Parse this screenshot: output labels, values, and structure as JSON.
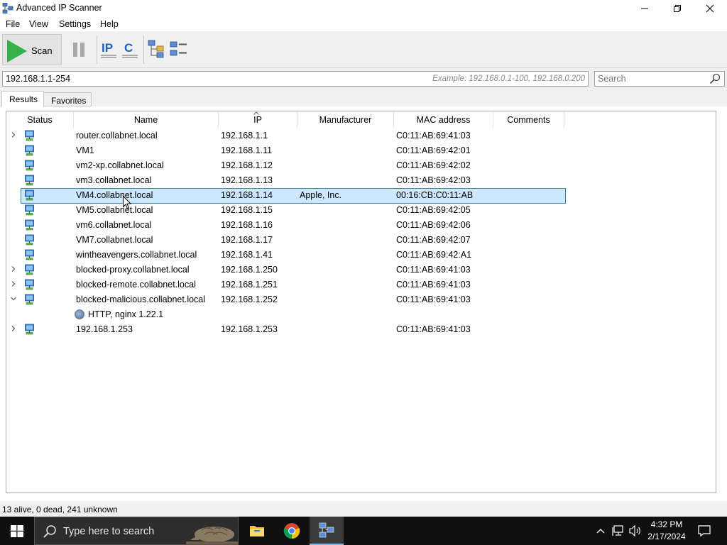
{
  "window": {
    "title": "Advanced IP Scanner"
  },
  "menu": [
    "File",
    "View",
    "Settings",
    "Help"
  ],
  "toolbar": {
    "scan_label": "Scan"
  },
  "address": {
    "value": "192.168.1.1-254",
    "example": "Example: 192.168.0.1-100, 192.168.0.200",
    "search_placeholder": "Search"
  },
  "tabs": [
    "Results",
    "Favorites"
  ],
  "columns": [
    "Status",
    "Name",
    "IP",
    "Manufacturer",
    "MAC address",
    "Comments"
  ],
  "rows": [
    {
      "expander": "collapsed",
      "name": "router.collabnet.local",
      "ip": "192.168.1.1",
      "manufacturer": "",
      "mac": "C0:11:AB:69:41:03"
    },
    {
      "expander": "none",
      "name": "VM1",
      "ip": "192.168.1.11",
      "manufacturer": "",
      "mac": "C0:11:AB:69:42:01"
    },
    {
      "expander": "none",
      "name": "vm2-xp.collabnet.local",
      "ip": "192.168.1.12",
      "manufacturer": "",
      "mac": "C0:11:AB:69:42:02"
    },
    {
      "expander": "none",
      "name": "vm3.collabnet.local",
      "ip": "192.168.1.13",
      "manufacturer": "",
      "mac": "C0:11:AB:69:42:03"
    },
    {
      "expander": "none",
      "name": "VM4.collabnet.local",
      "ip": "192.168.1.14",
      "manufacturer": "Apple, Inc.",
      "mac": "00:16:CB:C0:11:AB",
      "selected": true
    },
    {
      "expander": "none",
      "name": "VM5.collabnet.local",
      "ip": "192.168.1.15",
      "manufacturer": "",
      "mac": "C0:11:AB:69:42:05"
    },
    {
      "expander": "none",
      "name": "vm6.collabnet.local",
      "ip": "192.168.1.16",
      "manufacturer": "",
      "mac": "C0:11:AB:69:42:06"
    },
    {
      "expander": "none",
      "name": "VM7.collabnet.local",
      "ip": "192.168.1.17",
      "manufacturer": "",
      "mac": "C0:11:AB:69:42:07"
    },
    {
      "expander": "none",
      "name": "wintheavengers.collabnet.local",
      "ip": "192.168.1.41",
      "manufacturer": "",
      "mac": "C0:11:AB:69:42:A1"
    },
    {
      "expander": "collapsed",
      "name": "blocked-proxy.collabnet.local",
      "ip": "192.168.1.250",
      "manufacturer": "",
      "mac": "C0:11:AB:69:41:03"
    },
    {
      "expander": "collapsed",
      "name": "blocked-remote.collabnet.local",
      "ip": "192.168.1.251",
      "manufacturer": "",
      "mac": "C0:11:AB:69:41:03"
    },
    {
      "expander": "expanded",
      "name": "blocked-malicious.collabnet.local",
      "ip": "192.168.1.252",
      "manufacturer": "",
      "mac": "C0:11:AB:69:41:03"
    },
    {
      "child": true,
      "name": "HTTP, nginx 1.22.1"
    },
    {
      "expander": "collapsed",
      "name": "192.168.1.253",
      "ip": "192.168.1.253",
      "manufacturer": "",
      "mac": "C0:11:AB:69:41:03"
    }
  ],
  "status": {
    "text": "13 alive, 0 dead, 241 unknown"
  },
  "taskbar": {
    "search_placeholder": "Type here to search",
    "time": "4:32 PM",
    "date": "2/17/2024"
  },
  "colors": {
    "scan_green": "#35b24a",
    "selection_fill": "#cce8ff",
    "selection_border": "#3c7fb1",
    "taskbar": "#101010"
  }
}
